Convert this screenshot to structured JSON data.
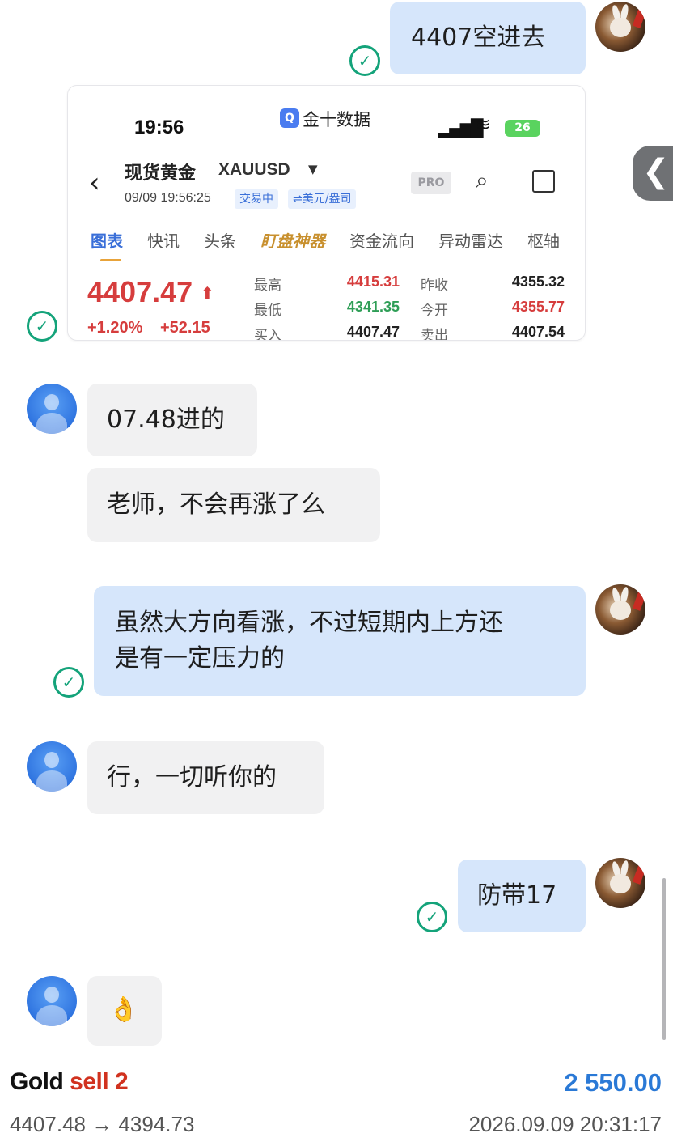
{
  "messages": {
    "m1": "4407空进去",
    "m2": "07.48进的",
    "m3": "老师，不会再涨了么",
    "m4_line1": "虽然大方向看涨，不过短期内上方还",
    "m4_line2": "是有一定压力的",
    "m5": "行，一切听你的",
    "m6": "防带17",
    "m7": "👌"
  },
  "read_check": "✓",
  "shot": {
    "time": "19:56",
    "app_name": "金十数据",
    "battery": "26",
    "product": "现货黄金",
    "symbol": "XAUUSD",
    "datetime": "09/09 19:56:25",
    "tag_trading": "交易中",
    "tag_unit": "⇌美元/盎司",
    "pro": "PRO",
    "tabs": [
      "图表",
      "快讯",
      "头条",
      "盯盘神器",
      "资金流向",
      "异动雷达",
      "枢轴"
    ],
    "price": "4407.47",
    "change_pct": "+1.20%",
    "change_abs": "+52.15",
    "quotes": {
      "high_label": "最高",
      "high": "4415.31",
      "low_label": "最低",
      "low": "4341.35",
      "bid_label": "买入",
      "bid": "4407.47",
      "prev_label": "昨收",
      "prev": "4355.32",
      "open_label": "今开",
      "open": "4355.77",
      "ask_label": "卖出",
      "ask": "4407.54"
    }
  },
  "footer": {
    "instrument": "Gold",
    "side": "sell 2",
    "amount": "2 550.00",
    "prices": "4407.48 → 4394.73",
    "timestamp": "2026.09.09 20:31:17"
  },
  "colors": {
    "self_bubble": "#d6e6fb",
    "other_bubble": "#f1f1f2",
    "check_green": "#14a37a",
    "price_red": "#d63d3d",
    "amount_blue": "#2a79d6"
  }
}
